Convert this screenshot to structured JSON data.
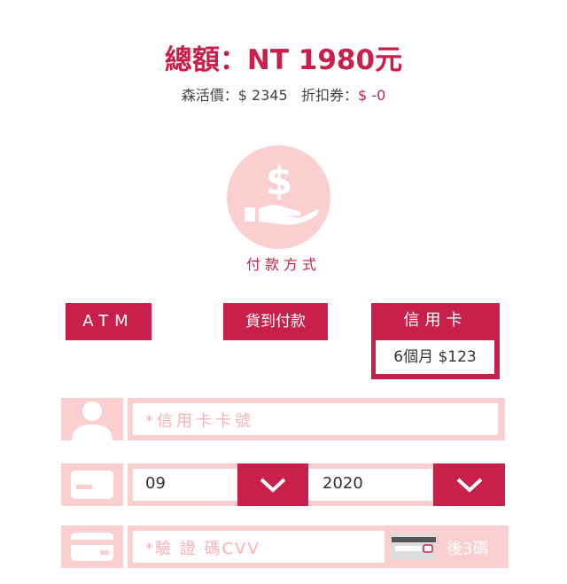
{
  "summary": {
    "total": "總額：NT 1980元",
    "price_label": "森活價：$ 2345",
    "coupon_label": "折扣券：",
    "coupon_value": "$ -0"
  },
  "payment": {
    "section_label": "付款方式",
    "options": {
      "atm": "ATM",
      "cod": "貨到付款",
      "credit": "信用卡"
    },
    "installment": "6個月   $123"
  },
  "form": {
    "card_number_placeholder": "*信用卡卡號",
    "expiry_month": "09",
    "expiry_year": "2020",
    "cvv_placeholder": "*驗 證 碼CVV",
    "cvv_hint": "後3碼"
  },
  "colors": {
    "accent": "#c8204a",
    "light_pink": "#fbcfd0"
  }
}
